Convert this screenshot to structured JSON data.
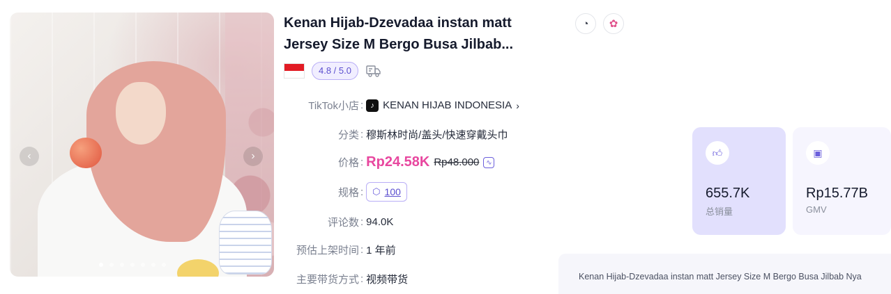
{
  "product": {
    "title_line1": "Kenan Hijab-Dzevadaa instan matt",
    "title_line2": "Jersey Size M Bergo Busa Jilbab...",
    "rating": "4.8 / 5.0",
    "country_flag": "indonesia-flag",
    "description": "Kenan Hijab-Dzevadaa instan matt Jersey Size M Bergo Busa Jilbab Nya"
  },
  "gallery": {
    "prev_icon": "chevron-left-icon",
    "next_icon": "chevron-right-icon",
    "dot_count": 7,
    "active_dot": 0
  },
  "fields": {
    "shop": {
      "label": "TikTok小店",
      "colon": ":",
      "value": "KENAN HIJAB INDONESIA",
      "chev": "›"
    },
    "category": {
      "label": "分类",
      "colon": ":",
      "value": "穆斯林时尚/盖头/快速穿戴头巾"
    },
    "price": {
      "label": "价格",
      "colon": ":",
      "current": "Rp24.58K",
      "original": "Rp48.000"
    },
    "spec": {
      "label": "规格",
      "colon": ":",
      "value": "100"
    },
    "reviews": {
      "label": "评论数",
      "colon": ":",
      "value": "94.0K"
    },
    "listed": {
      "label": "预估上架时间",
      "colon": ":",
      "value": "1 年前"
    },
    "channel": {
      "label": "主要带货方式",
      "colon": ":",
      "value": "视频带货"
    }
  },
  "stats": [
    {
      "value": "655.7K",
      "label": "总销量",
      "icon": "thumbs-up-icon"
    },
    {
      "value": "Rp15.77B",
      "label": "GMV",
      "icon": "wallet-icon"
    }
  ],
  "colors": {
    "accent": "#6b5fdc",
    "price": "#e8479f",
    "card_primary": "#e2e0fd",
    "card_secondary": "#f6f5fe"
  }
}
